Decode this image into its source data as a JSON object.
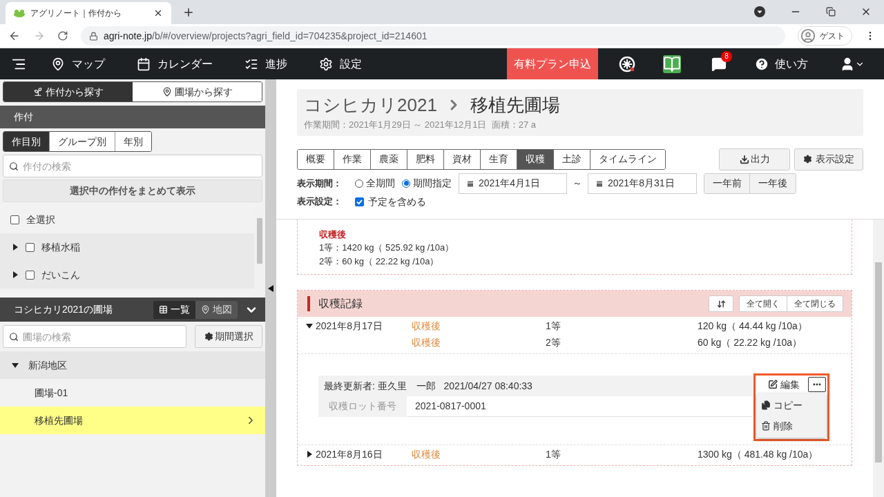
{
  "browser": {
    "tab_title": "アグリノート｜作付から",
    "url_domain": "agri-note.jp",
    "url_path": "/b/#/overview/projects?agri_field_id=704235&project_id=214601",
    "profile": "ゲスト"
  },
  "navbar": {
    "items": [
      {
        "kind": "map",
        "label": "マップ"
      },
      {
        "kind": "calendar",
        "label": "カレンダー"
      },
      {
        "kind": "progress",
        "label": "進捗"
      },
      {
        "kind": "settings",
        "label": "設定"
      }
    ],
    "plan_button": "有料プラン申込",
    "notification_count": "8",
    "help": "使い方"
  },
  "sidebar": {
    "search_modes": [
      {
        "kind": "crop",
        "label": "作付から探す",
        "selected": true
      },
      {
        "kind": "field",
        "label": "圃場から探す",
        "selected": false
      }
    ],
    "crop_header": "作付",
    "filters": [
      {
        "label": "作目別",
        "selected": true
      },
      {
        "label": "グループ別",
        "selected": false
      },
      {
        "label": "年別",
        "selected": false
      }
    ],
    "crop_search": {
      "placeholder": "作付の検索"
    },
    "show_selected_button": "選択中の作付をまとめて表示",
    "select_all": {
      "label": "全選択",
      "checked": false
    },
    "crops": [
      {
        "label": "移植水稲",
        "checked": false,
        "expanded": false
      },
      {
        "label": "だいこん",
        "checked": false,
        "expanded": false
      }
    ],
    "fields_header": "コシヒカリ2021の圃場",
    "views": [
      {
        "kind": "list",
        "label": "一覧",
        "selected": true
      },
      {
        "kind": "map",
        "label": "地図",
        "selected": false
      }
    ],
    "field_search": {
      "placeholder": "圃場の検索"
    },
    "period_button": "期間選択",
    "tree": [
      {
        "label": "新潟地区",
        "expanded": true,
        "children": [
          {
            "label": "圃場-01",
            "selected": false
          },
          {
            "label": "移植先圃場",
            "selected": true
          }
        ]
      }
    ]
  },
  "main": {
    "crop": "コシヒカリ2021",
    "field": "移植先圃場",
    "subtitle": "作業期間：2021年1月29日 ～ 2021年12月1日  面積：27 a",
    "tabs": [
      {
        "label": "概要",
        "selected": false
      },
      {
        "label": "作業",
        "selected": false
      },
      {
        "label": "農薬",
        "selected": false
      },
      {
        "label": "肥料",
        "selected": false
      },
      {
        "label": "資材",
        "selected": false
      },
      {
        "label": "生育",
        "selected": false
      },
      {
        "label": "収穫",
        "selected": true
      },
      {
        "label": "土診",
        "selected": false
      },
      {
        "label": "タイムライン",
        "selected": false
      }
    ],
    "export_button": "出力",
    "display_settings_button": "表示設定",
    "period_label": "表示期間：",
    "period_options": [
      {
        "label": "全期間",
        "selected": false
      },
      {
        "label": "期間指定",
        "selected": true
      }
    ],
    "date_from": "2021年4月1日",
    "date_sep": "～",
    "date_to": "2021年8月31日",
    "prev_year": "一年前",
    "next_year": "一年後",
    "settings_label": "表示設定：",
    "include_planned": {
      "label": "予定を含める",
      "checked": true
    },
    "summary": {
      "stage": "収穫後",
      "lines": [
        "1等：1420 kg（ 525.92 kg /10a）",
        "2等：60 kg（ 22.22 kg /10a）"
      ]
    },
    "records_title": "収穫記録",
    "expand_all": "全て開く",
    "collapse_all": "全て閉じる",
    "records": [
      {
        "date": "2021年8月17日",
        "expanded": true,
        "lines": [
          {
            "stage": "収穫後",
            "grade": "1等",
            "amount": "120 kg（ 44.44 kg /10a）"
          },
          {
            "stage": "収穫後",
            "grade": "2等",
            "amount": "60 kg（ 22.22 kg /10a）"
          }
        ],
        "updated": "最終更新者: 亜久里　一郎   2021/04/27 08:40:33",
        "edit": "編集",
        "lot_label": "収穫ロット番号",
        "lot_value": "2021-0817-0001",
        "menu": [
          {
            "kind": "copy",
            "label": "コピー"
          },
          {
            "kind": "delete",
            "label": "削除"
          }
        ]
      },
      {
        "date": "2021年8月16日",
        "expanded": false,
        "lines": [
          {
            "stage": "収穫後",
            "grade": "1等",
            "amount": "1300 kg（ 481.48 kg /10a）"
          }
        ]
      }
    ]
  }
}
